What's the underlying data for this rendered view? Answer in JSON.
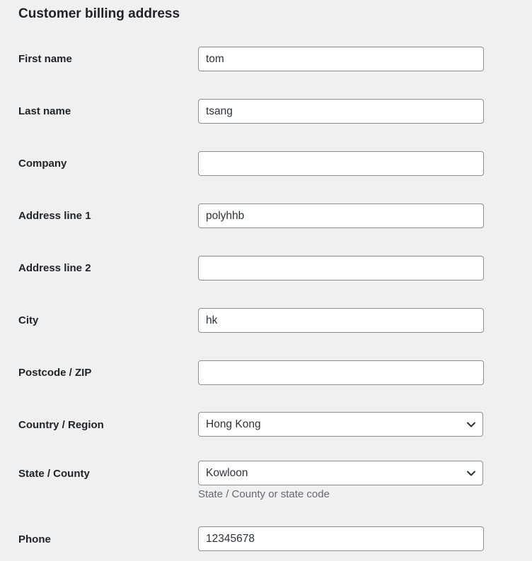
{
  "section": {
    "title": "Customer billing address"
  },
  "fields": {
    "first_name": {
      "label": "First name",
      "value": "tom"
    },
    "last_name": {
      "label": "Last name",
      "value": "tsang"
    },
    "company": {
      "label": "Company",
      "value": ""
    },
    "address_1": {
      "label": "Address line 1",
      "value": "polyhhb"
    },
    "address_2": {
      "label": "Address line 2",
      "value": ""
    },
    "city": {
      "label": "City",
      "value": "hk"
    },
    "postcode": {
      "label": "Postcode / ZIP",
      "value": ""
    },
    "country": {
      "label": "Country / Region",
      "value": "Hong Kong"
    },
    "state": {
      "label": "State / County",
      "value": "Kowloon",
      "description": "State / County or state code"
    },
    "phone": {
      "label": "Phone",
      "value": "12345678"
    }
  },
  "icons": {
    "select_arrow": "chevron-down-icon"
  }
}
